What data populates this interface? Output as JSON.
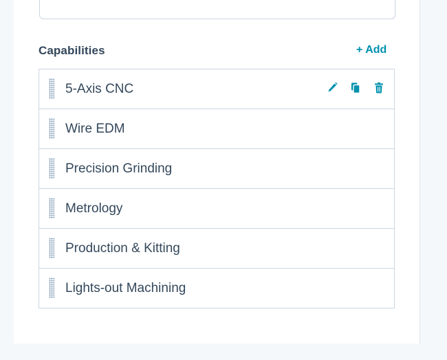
{
  "section": {
    "title": "Capabilities",
    "add_label": "+ Add"
  },
  "capabilities": [
    {
      "label": "5-Axis CNC",
      "actions": [
        "pencil-icon",
        "copy-icon",
        "trash-icon"
      ]
    },
    {
      "label": "Wire EDM"
    },
    {
      "label": "Precision Grinding"
    },
    {
      "label": "Metrology"
    },
    {
      "label": "Production & Kitting"
    },
    {
      "label": "Lights-out Machining"
    }
  ],
  "colors": {
    "accent": "#0091ae",
    "text": "#33475b",
    "border": "#cbd6e2",
    "background": "#f5f8fa"
  }
}
